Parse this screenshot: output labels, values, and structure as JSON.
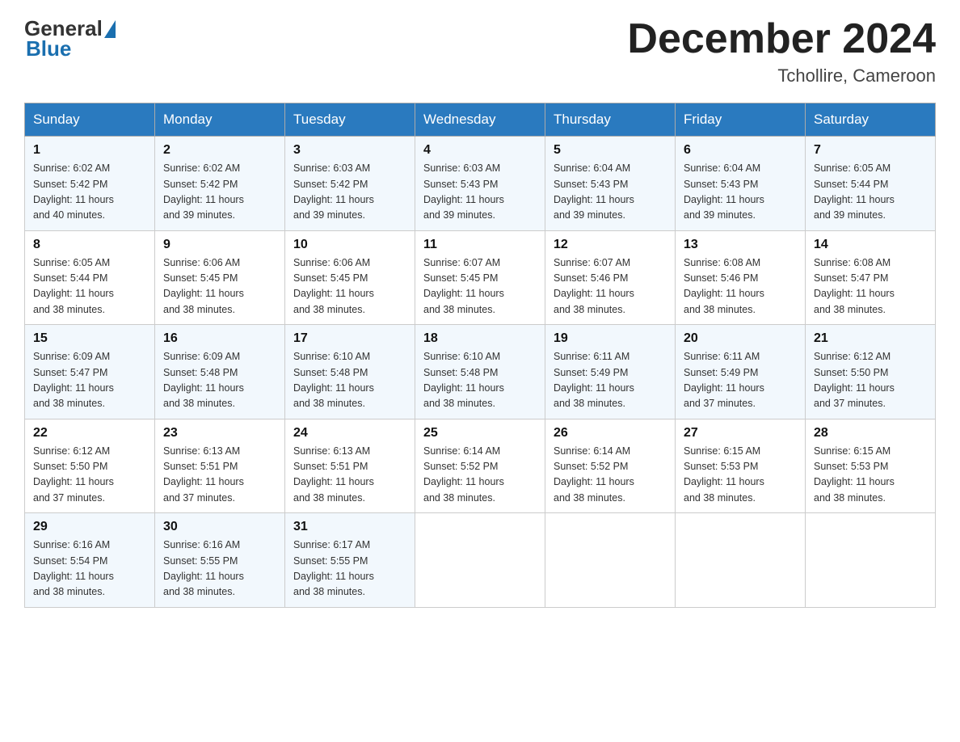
{
  "header": {
    "logo": {
      "general": "General",
      "blue": "Blue"
    },
    "title": "December 2024",
    "location": "Tchollire, Cameroon"
  },
  "calendar": {
    "days_of_week": [
      "Sunday",
      "Monday",
      "Tuesday",
      "Wednesday",
      "Thursday",
      "Friday",
      "Saturday"
    ],
    "weeks": [
      [
        {
          "day": "1",
          "sunrise": "6:02 AM",
          "sunset": "5:42 PM",
          "daylight": "11 hours and 40 minutes."
        },
        {
          "day": "2",
          "sunrise": "6:02 AM",
          "sunset": "5:42 PM",
          "daylight": "11 hours and 39 minutes."
        },
        {
          "day": "3",
          "sunrise": "6:03 AM",
          "sunset": "5:42 PM",
          "daylight": "11 hours and 39 minutes."
        },
        {
          "day": "4",
          "sunrise": "6:03 AM",
          "sunset": "5:43 PM",
          "daylight": "11 hours and 39 minutes."
        },
        {
          "day": "5",
          "sunrise": "6:04 AM",
          "sunset": "5:43 PM",
          "daylight": "11 hours and 39 minutes."
        },
        {
          "day": "6",
          "sunrise": "6:04 AM",
          "sunset": "5:43 PM",
          "daylight": "11 hours and 39 minutes."
        },
        {
          "day": "7",
          "sunrise": "6:05 AM",
          "sunset": "5:44 PM",
          "daylight": "11 hours and 39 minutes."
        }
      ],
      [
        {
          "day": "8",
          "sunrise": "6:05 AM",
          "sunset": "5:44 PM",
          "daylight": "11 hours and 38 minutes."
        },
        {
          "day": "9",
          "sunrise": "6:06 AM",
          "sunset": "5:45 PM",
          "daylight": "11 hours and 38 minutes."
        },
        {
          "day": "10",
          "sunrise": "6:06 AM",
          "sunset": "5:45 PM",
          "daylight": "11 hours and 38 minutes."
        },
        {
          "day": "11",
          "sunrise": "6:07 AM",
          "sunset": "5:45 PM",
          "daylight": "11 hours and 38 minutes."
        },
        {
          "day": "12",
          "sunrise": "6:07 AM",
          "sunset": "5:46 PM",
          "daylight": "11 hours and 38 minutes."
        },
        {
          "day": "13",
          "sunrise": "6:08 AM",
          "sunset": "5:46 PM",
          "daylight": "11 hours and 38 minutes."
        },
        {
          "day": "14",
          "sunrise": "6:08 AM",
          "sunset": "5:47 PM",
          "daylight": "11 hours and 38 minutes."
        }
      ],
      [
        {
          "day": "15",
          "sunrise": "6:09 AM",
          "sunset": "5:47 PM",
          "daylight": "11 hours and 38 minutes."
        },
        {
          "day": "16",
          "sunrise": "6:09 AM",
          "sunset": "5:48 PM",
          "daylight": "11 hours and 38 minutes."
        },
        {
          "day": "17",
          "sunrise": "6:10 AM",
          "sunset": "5:48 PM",
          "daylight": "11 hours and 38 minutes."
        },
        {
          "day": "18",
          "sunrise": "6:10 AM",
          "sunset": "5:48 PM",
          "daylight": "11 hours and 38 minutes."
        },
        {
          "day": "19",
          "sunrise": "6:11 AM",
          "sunset": "5:49 PM",
          "daylight": "11 hours and 38 minutes."
        },
        {
          "day": "20",
          "sunrise": "6:11 AM",
          "sunset": "5:49 PM",
          "daylight": "11 hours and 37 minutes."
        },
        {
          "day": "21",
          "sunrise": "6:12 AM",
          "sunset": "5:50 PM",
          "daylight": "11 hours and 37 minutes."
        }
      ],
      [
        {
          "day": "22",
          "sunrise": "6:12 AM",
          "sunset": "5:50 PM",
          "daylight": "11 hours and 37 minutes."
        },
        {
          "day": "23",
          "sunrise": "6:13 AM",
          "sunset": "5:51 PM",
          "daylight": "11 hours and 37 minutes."
        },
        {
          "day": "24",
          "sunrise": "6:13 AM",
          "sunset": "5:51 PM",
          "daylight": "11 hours and 38 minutes."
        },
        {
          "day": "25",
          "sunrise": "6:14 AM",
          "sunset": "5:52 PM",
          "daylight": "11 hours and 38 minutes."
        },
        {
          "day": "26",
          "sunrise": "6:14 AM",
          "sunset": "5:52 PM",
          "daylight": "11 hours and 38 minutes."
        },
        {
          "day": "27",
          "sunrise": "6:15 AM",
          "sunset": "5:53 PM",
          "daylight": "11 hours and 38 minutes."
        },
        {
          "day": "28",
          "sunrise": "6:15 AM",
          "sunset": "5:53 PM",
          "daylight": "11 hours and 38 minutes."
        }
      ],
      [
        {
          "day": "29",
          "sunrise": "6:16 AM",
          "sunset": "5:54 PM",
          "daylight": "11 hours and 38 minutes."
        },
        {
          "day": "30",
          "sunrise": "6:16 AM",
          "sunset": "5:55 PM",
          "daylight": "11 hours and 38 minutes."
        },
        {
          "day": "31",
          "sunrise": "6:17 AM",
          "sunset": "5:55 PM",
          "daylight": "11 hours and 38 minutes."
        },
        null,
        null,
        null,
        null
      ]
    ]
  }
}
